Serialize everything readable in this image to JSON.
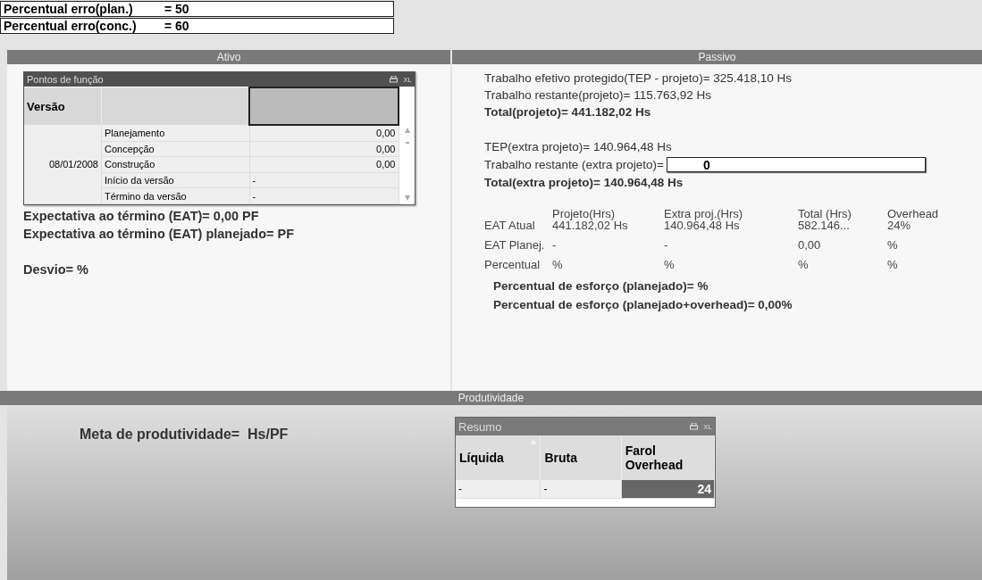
{
  "error_fields": [
    {
      "label": "Percentual erro(plan.)",
      "value": "= 50"
    },
    {
      "label": "Percentual erro(conc.)",
      "value": "= 60"
    }
  ],
  "ativo": {
    "title": "Ativo",
    "pontos_table": {
      "title": "Pontos de função",
      "xl_label": "XL",
      "columns": [
        "Versão",
        "",
        ""
      ],
      "version": "08/01/2008",
      "rows": [
        {
          "phase": "Planejamento",
          "value": "0,00"
        },
        {
          "phase": "Concepção",
          "value": "0,00"
        },
        {
          "phase": "Construção",
          "value": "0,00"
        },
        {
          "phase": "Início da versão",
          "value": "-"
        },
        {
          "phase": "Término da versão",
          "value": "-"
        }
      ]
    },
    "lines": [
      "Expectativa ao término (EAT)= 0,00 PF",
      "Expectativa ao término (EAT) planejado= PF"
    ],
    "desvio": "Desvio= %"
  },
  "passivo": {
    "title": "Passivo",
    "project_lines": [
      {
        "text": "Trabalho efetivo protegido(TEP - projeto)= 325.418,10 Hs",
        "bold": false
      },
      {
        "text": "Trabalho restante(projeto)= 115.763,92 Hs",
        "bold": false
      },
      {
        "text": "Total(projeto)= 441.182,02 Hs",
        "bold": true
      }
    ],
    "tep_extra": "TEP(extra projeto)= 140.964,48 Hs",
    "restante_extra": {
      "label": "Trabalho restante (extra projeto)=",
      "value": "0"
    },
    "total_extra": "Total(extra projeto)= 140.964,48 Hs",
    "eat_table": {
      "columns": [
        "",
        "Projeto(Hrs)",
        "Extra proj.(Hrs)",
        "Total (Hrs)",
        "Overhead"
      ],
      "rows": [
        [
          "EAT Atual",
          "441.182,02 Hs",
          "140.964,48 Hs",
          "582.146...",
          "24%"
        ],
        [
          "EAT Planej.",
          "-",
          "-",
          "0,00",
          "%"
        ],
        [
          "Percentual",
          "%",
          "%",
          "%",
          "%"
        ]
      ]
    },
    "esforco": [
      "Percentual de esforço (planejado)= %",
      "Percentual de esforço (planejado+overhead)= 0,00%"
    ]
  },
  "produtividade": {
    "title": "Produtividade",
    "meta": "Meta de produtividade=  Hs/PF",
    "resumo": {
      "title": "Resumo",
      "xl_label": "XL",
      "columns": [
        {
          "label": "Líquida",
          "sorted": true
        },
        {
          "label": "Bruta",
          "sorted": false
        },
        {
          "label": "Farol Overhead",
          "sorted": false
        }
      ],
      "row": [
        {
          "value": "-",
          "highlight": false
        },
        {
          "value": "-",
          "highlight": false
        },
        {
          "value": "24",
          "highlight": true
        }
      ]
    }
  }
}
